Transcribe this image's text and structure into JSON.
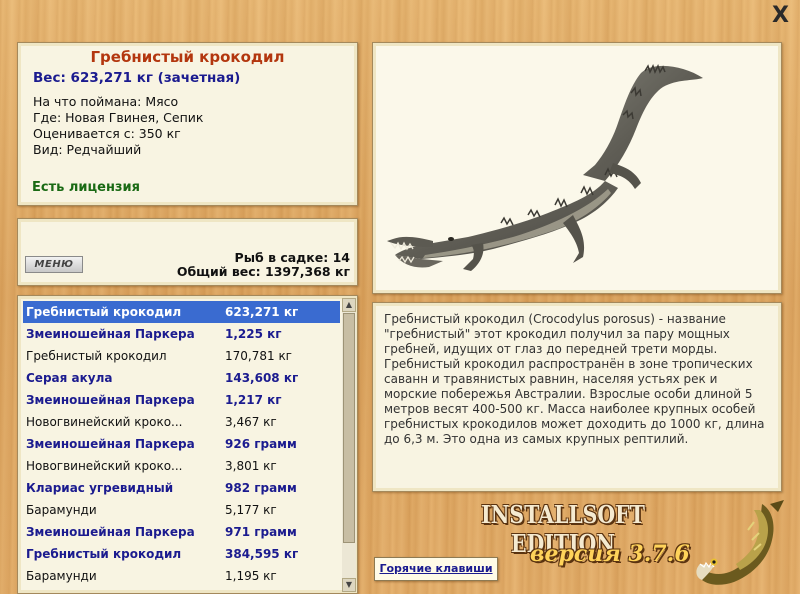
{
  "close_button": "X",
  "catch_info": {
    "title": "Гребнистый крокодил",
    "weight_line": "Вес: 623,271 кг (зачетная)",
    "bait": "На что поймана: Мясо",
    "location": "Где: Новая Гвинея, Сепик",
    "valued": "Оценивается с: 350 кг",
    "rarity": "Вид: Редчайший",
    "license": "Есть лицензия"
  },
  "stats": {
    "menu_label": "МЕНЮ",
    "fish_count": "Рыб в садке: 14",
    "total_weight": "Общий вес: 1397,368 кг"
  },
  "catch_list": [
    {
      "name": "Гребнистый крокодил",
      "weight": "623,271 кг",
      "style": "sel"
    },
    {
      "name": "Змеиношейная Паркера",
      "weight": "1,225 кг",
      "style": "b"
    },
    {
      "name": "Гребнистый крокодил",
      "weight": "170,781 кг",
      "style": "n"
    },
    {
      "name": "Серая акула",
      "weight": "143,608 кг",
      "style": "b"
    },
    {
      "name": "Змеиношейная Паркера",
      "weight": "1,217 кг",
      "style": "b"
    },
    {
      "name": "Новогвинейский кроко...",
      "weight": "3,467 кг",
      "style": "n"
    },
    {
      "name": "Змеиношейная Паркера",
      "weight": "926 грамм",
      "style": "b"
    },
    {
      "name": "Новогвинейский кроко...",
      "weight": "3,801 кг",
      "style": "n"
    },
    {
      "name": "Клариас угревидный",
      "weight": "982 грамм",
      "style": "b"
    },
    {
      "name": "Барамунди",
      "weight": "5,177 кг",
      "style": "n"
    },
    {
      "name": "Змеиношейная Паркера",
      "weight": "971 грамм",
      "style": "b"
    },
    {
      "name": "Гребнистый крокодил",
      "weight": "384,595 кг",
      "style": "b"
    },
    {
      "name": "Барамунди",
      "weight": "1,195 кг",
      "style": "n"
    }
  ],
  "description": "Гребнистый крокодил (Crocodylus porosus) - название \"гребнистый\" этот крокодил получил за пару мощных гребней, идущих от глаз до передней трети морды. Гребнистый крокодил распространён в зоне тропических саванн и травянистых равнин, населяя устьях рек и морские побережья Австралии. Взрослые особи длиной 5 метров весят 400-500 кг. Масса наиболее крупных особей гребнистых крокодилов может доходить до 1000 кг, длина до 6,3 м. Это одна из самых крупных рептилий.",
  "hotkeys_label": "Горячие клавиши",
  "branding": {
    "edition": "INSTALLSOFT EDITION",
    "version": "версия 3.7.6"
  },
  "colors": {
    "title_red": "#b3360e",
    "weight_blue": "#1b1b8f",
    "license_green": "#1a6a14",
    "selection": "#3a6bd0"
  }
}
